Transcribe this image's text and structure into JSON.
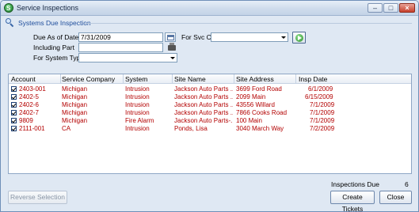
{
  "window": {
    "title": "Service Inspections"
  },
  "section": {
    "title": "Systems Due Inspection"
  },
  "filters": {
    "due_as_of_label": "Due As of Date",
    "due_as_of_value": "7/31/2009",
    "for_svc_co_label": "For Svc Co",
    "for_svc_co_value": "",
    "including_part_label": "Including Part",
    "including_part_value": "",
    "for_system_type_label": "For System Type",
    "for_system_type_value": ""
  },
  "grid": {
    "columns": [
      "Account",
      "Service Company",
      "System",
      "Site Name",
      "Site Address",
      "Insp Date"
    ],
    "rows": [
      {
        "checked": true,
        "account": "2403-001",
        "service_company": "Michigan",
        "system": "Intrusion",
        "site_name": "Jackson Auto Parts ...",
        "site_address": "3699 Ford Road",
        "insp_date": "6/1/2009"
      },
      {
        "checked": true,
        "account": "2402-5",
        "service_company": "Michigan",
        "system": "Intrusion",
        "site_name": "Jackson Auto Parts ...",
        "site_address": "2099 Main",
        "insp_date": "6/15/2009"
      },
      {
        "checked": true,
        "account": "2402-6",
        "service_company": "Michigan",
        "system": "Intrusion",
        "site_name": "Jackson Auto Parts ...",
        "site_address": "43556 Willard",
        "insp_date": "7/1/2009"
      },
      {
        "checked": true,
        "account": "2402-7",
        "service_company": "Michigan",
        "system": "Intrusion",
        "site_name": "Jackson Auto Parts ...",
        "site_address": "7866 Cooks Road",
        "insp_date": "7/1/2009"
      },
      {
        "checked": true,
        "account": "9809",
        "service_company": "Michigan",
        "system": "Fire Alarm",
        "site_name": "Jackson Auto Parts-...",
        "site_address": "100 Main",
        "insp_date": "7/1/2009"
      },
      {
        "checked": true,
        "account": "2111-001",
        "service_company": "CA",
        "system": "Intrusion",
        "site_name": "Ponds, Lisa",
        "site_address": "3040 March Way",
        "insp_date": "7/2/2009"
      }
    ]
  },
  "summary": {
    "inspections_due_label": "Inspections Due",
    "inspections_due_count": "6"
  },
  "buttons": {
    "reverse_selection": "Reverse Selection",
    "create_tickets": "Create Tickets",
    "close": "Close"
  },
  "colors": {
    "row_text": "#b30000",
    "section_title": "#1f4e9c"
  },
  "icons": [
    "app-icon",
    "magnifier-icon",
    "calendar-icon",
    "parts-icon",
    "go-arrow-icon",
    "minimize-icon",
    "maximize-icon",
    "close-icon",
    "checkbox-checked-icon"
  ]
}
